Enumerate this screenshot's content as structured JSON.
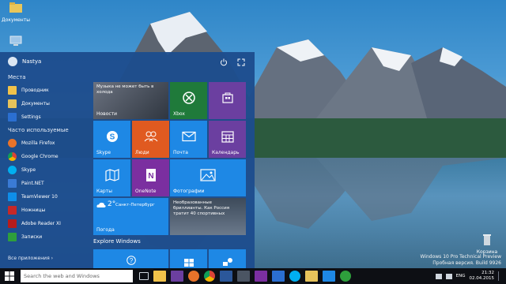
{
  "desktop": {
    "icons": [
      {
        "label": "Документы",
        "name": "documents"
      },
      {
        "label": "Корзина",
        "name": "recycle-bin"
      }
    ],
    "watermark": {
      "line1": "Windows 10 Pro Technical Preview",
      "line2": "Пробная версия. Build 9926"
    }
  },
  "start_menu": {
    "user_name": "Nastya",
    "places_title": "Места",
    "places": [
      "Проводник",
      "Документы",
      "Settings"
    ],
    "frequent_title": "Часто используемые",
    "frequent": [
      "Mozilla Firefox",
      "Google Chrome",
      "Skype",
      "Paint.NET",
      "TeamViewer 10",
      "Ножницы",
      "Adobe Reader XI",
      "Записки"
    ],
    "all_apps": "Все приложения",
    "tiles": {
      "news_headline": "Музыка не может быть в холода",
      "news_label": "Новости",
      "xbox": "Xbox",
      "store": "Магазин",
      "skype": "Skype",
      "people": "Люди",
      "mail": "Почта",
      "calendar": "Календарь",
      "maps": "Карты",
      "onenote": "OneNote",
      "photos": "Фотографии",
      "weather_temp": "2°",
      "weather_city": "Санкт-Петербург",
      "weather_label": "Погода",
      "sports_headline": "Необразованные бриллианты. Как Россия тратит 40 спортивных",
      "explore_title": "Explore Windows"
    }
  },
  "taskbar": {
    "search_placeholder": "Search the web and Windows",
    "language": "ENG",
    "time": "21:32",
    "date": "02.04.2015"
  },
  "colors": {
    "start_bg": "#1d4d8e",
    "accent_blue": "#1e88e5",
    "tile_orange": "#e05a20",
    "tile_purple": "#6b3fa0",
    "tile_green": "#1f7a3a",
    "taskbar_bg": "#0d0f14"
  }
}
